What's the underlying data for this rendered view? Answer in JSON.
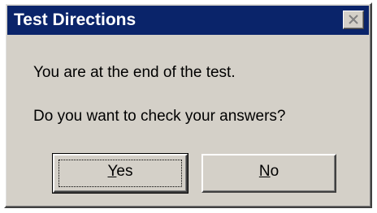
{
  "window": {
    "title": "Test Directions",
    "titlebar_color": "#0a246a",
    "background_color": "#d4d0c8",
    "close_icon": "close-icon"
  },
  "message": {
    "line1": "You are at the end of the test.",
    "line2": "Do you want to check your answers?"
  },
  "buttons": {
    "yes": {
      "mnemonic": "Y",
      "rest": "es",
      "label": "Yes",
      "focused": true
    },
    "no": {
      "mnemonic": "N",
      "rest": "o",
      "label": "No",
      "focused": false
    }
  }
}
